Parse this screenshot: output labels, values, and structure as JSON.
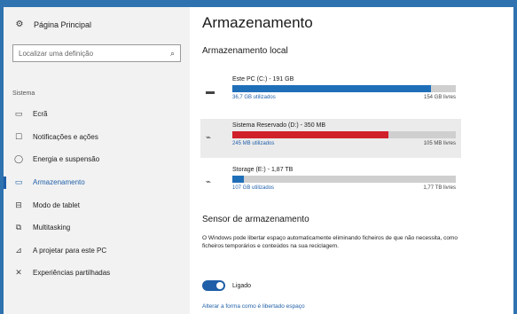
{
  "sidebar": {
    "home_label": "Página Principal",
    "search_placeholder": "Localizar uma definição",
    "section_label": "Sistema",
    "items": [
      {
        "label": "Ecrã",
        "icon": "monitor-icon"
      },
      {
        "label": "Notificações e ações",
        "icon": "notifications-icon"
      },
      {
        "label": "Energia e suspensão",
        "icon": "power-icon"
      },
      {
        "label": "Armazenamento",
        "icon": "storage-icon"
      },
      {
        "label": "Modo de tablet",
        "icon": "tablet-icon"
      },
      {
        "label": "Multitasking",
        "icon": "multitasking-icon"
      },
      {
        "label": "A projetar para este PC",
        "icon": "project-icon"
      },
      {
        "label": "Experiências partilhadas",
        "icon": "shared-experiences-icon"
      }
    ],
    "active_index": 3
  },
  "main": {
    "title": "Armazenamento",
    "subtitle": "Armazenamento local",
    "drives": [
      {
        "name": "Este PC (C:) - 191 GB",
        "used": "36,7 GB utilizados",
        "free": "154 GB livres",
        "fraction": 0.89,
        "color": "#1f6fb8",
        "selected": false
      },
      {
        "name": "Sistema Reservado (D:) - 350 MB",
        "used": "245 MB utilizados",
        "free": "105 MB livres",
        "fraction": 0.7,
        "color": "#d0202a",
        "selected": true
      },
      {
        "name": "Storage (E:) - 1,87 TB",
        "used": "107 GB utilizados",
        "free": "1,77 TB livres",
        "fraction": 0.05,
        "color": "#1f6fb8",
        "selected": false
      }
    ],
    "sensor_heading": "Sensor de armazenamento",
    "sensor_description": "O Windows pode libertar espaço automaticamente eliminando ficheiros de que não necessita, como ficheiros temporários e conteúdos na sua reciclagem.",
    "toggle_label": "Ligado",
    "toggle_on": true,
    "link": "Alterar a forma como é libertado espaço"
  },
  "colors": {
    "accent": "#1f5fa8",
    "outer_background": "#2f72b0"
  }
}
